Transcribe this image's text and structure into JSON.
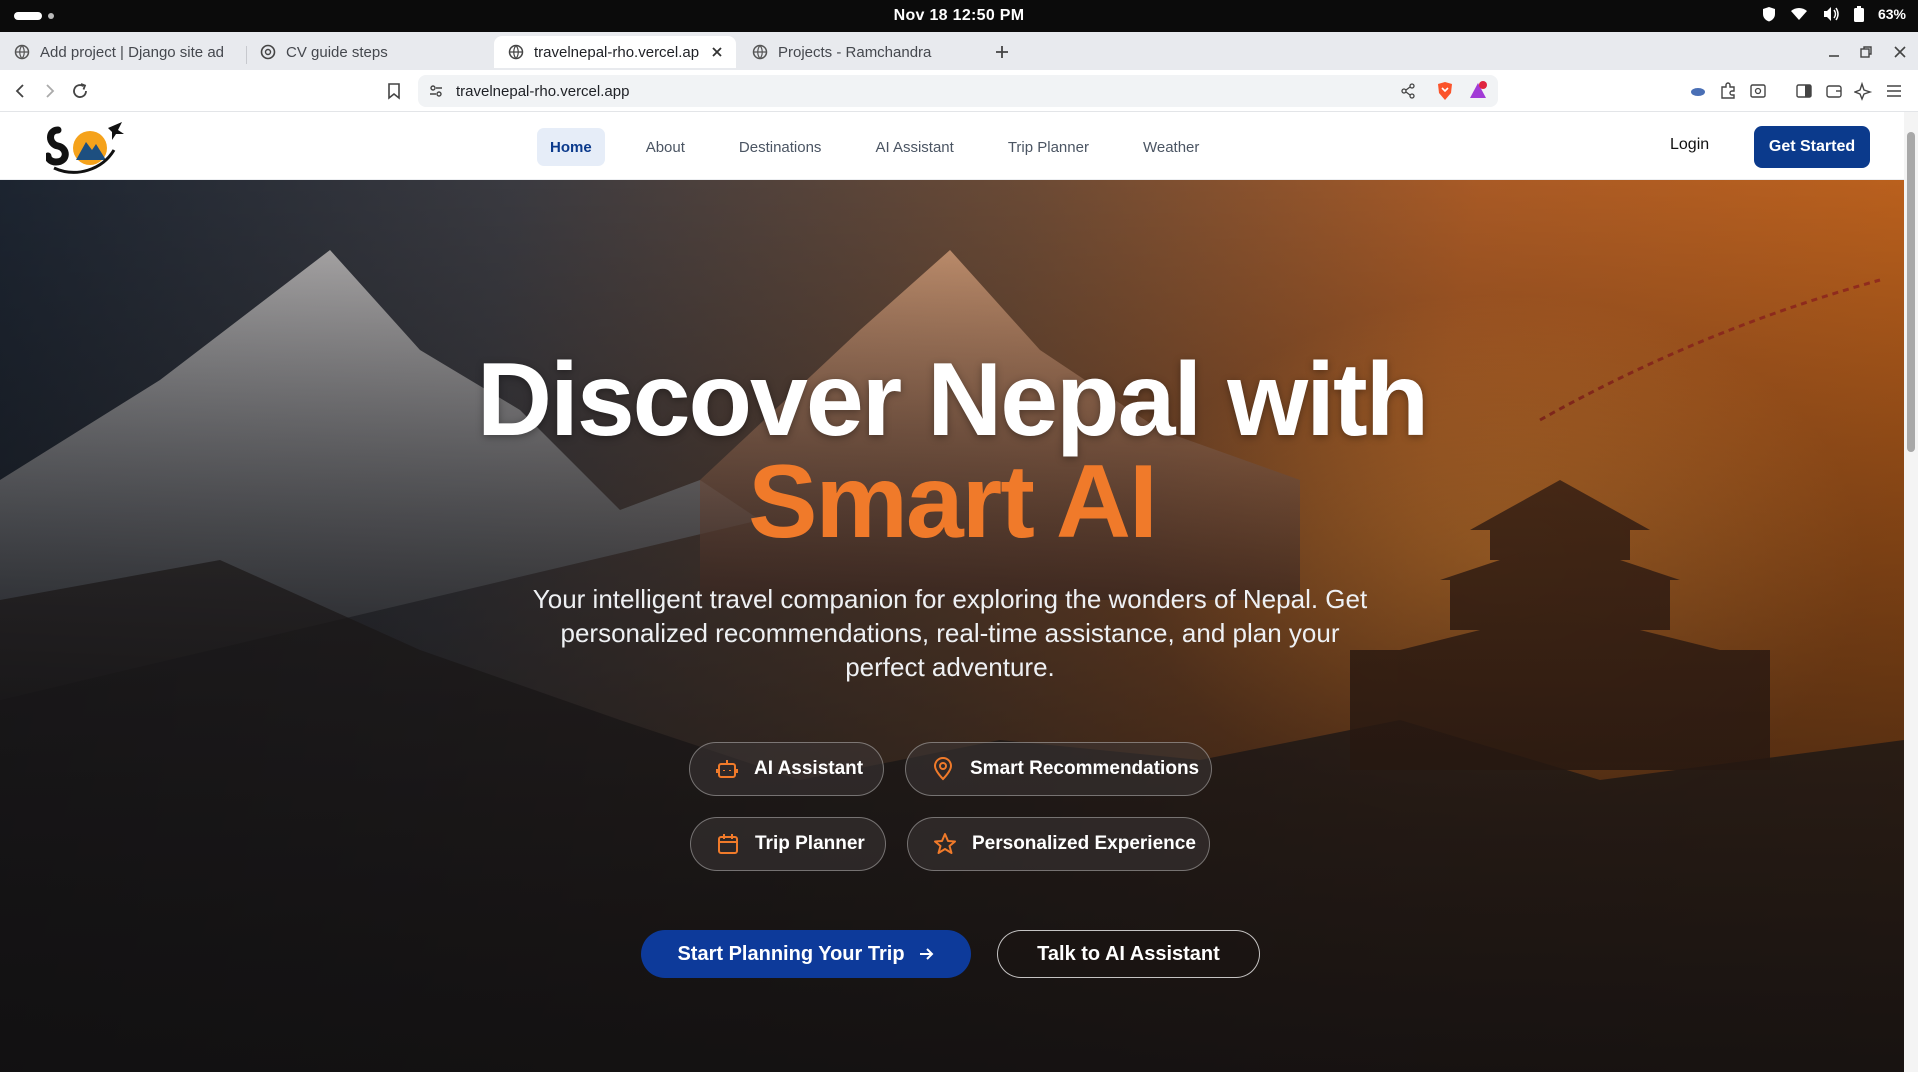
{
  "os": {
    "clock": "Nov 18  12:50 PM",
    "battery": "63%"
  },
  "tabs": [
    {
      "label": "Add project | Django site ad",
      "active": false
    },
    {
      "label": "CV guide steps",
      "active": false
    },
    {
      "label": "travelnepal-rho.vercel.ap",
      "active": true
    },
    {
      "label": "Projects - Ramchandra",
      "active": false
    }
  ],
  "address_bar": {
    "url": "travelnepal-rho.vercel.app"
  },
  "site_nav": {
    "links": [
      "Home",
      "About",
      "Destinations",
      "AI Assistant",
      "Trip Planner",
      "Weather"
    ],
    "active": "Home",
    "login": "Login",
    "get_started": "Get Started"
  },
  "hero": {
    "title": "Discover Nepal with",
    "title_accent": "Smart AI",
    "subtitle": "Your intelligent travel companion for exploring the wonders of Nepal. Get personalized recommendations, real-time assistance, and plan your perfect adventure.",
    "features": [
      {
        "label": "AI Assistant",
        "icon": "robot-icon"
      },
      {
        "label": "Smart Recommendations",
        "icon": "map-pin-icon"
      },
      {
        "label": "Trip Planner",
        "icon": "calendar-icon"
      },
      {
        "label": "Personalized Experience",
        "icon": "star-icon"
      }
    ],
    "cta_primary": "Start Planning Your Trip",
    "cta_secondary": "Talk to AI Assistant"
  },
  "colors": {
    "brand_blue": "#0b3a8c",
    "accent_orange": "#f07a2a"
  }
}
